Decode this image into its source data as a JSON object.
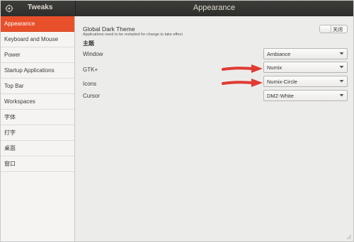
{
  "window": {
    "app_title": "Tweaks",
    "page_title": "Appearance"
  },
  "sidebar": {
    "items": [
      {
        "label": "Appearance",
        "active": true
      },
      {
        "label": "Keyboard and Mouse",
        "active": false
      },
      {
        "label": "Power",
        "active": false
      },
      {
        "label": "Startup Applications",
        "active": false
      },
      {
        "label": "Top Bar",
        "active": false
      },
      {
        "label": "Workspaces",
        "active": false
      },
      {
        "label": "字体",
        "active": false
      },
      {
        "label": "打字",
        "active": false
      },
      {
        "label": "桌面",
        "active": false
      },
      {
        "label": "窗口",
        "active": false
      }
    ]
  },
  "main": {
    "dark_theme": {
      "title": "Global Dark Theme",
      "subtitle": "Applications need to be restarted for change to take effect",
      "toggle_label": "关闭",
      "enabled": false
    },
    "section_heading": "主题",
    "rows": [
      {
        "label": "Window",
        "value": "Ambiance"
      },
      {
        "label": "GTK+",
        "value": "Numix"
      },
      {
        "label": "Icons",
        "value": "Numix-Circle"
      },
      {
        "label": "Cursor",
        "value": "DMZ-White"
      }
    ]
  },
  "colors": {
    "accent": "#e8502b",
    "titlebar": "#3a3a37",
    "annotation_arrow": "#e03a32"
  },
  "icons": {
    "app_icon": "tweaks-icon",
    "dropdown_icon": "chevron-down-icon"
  }
}
